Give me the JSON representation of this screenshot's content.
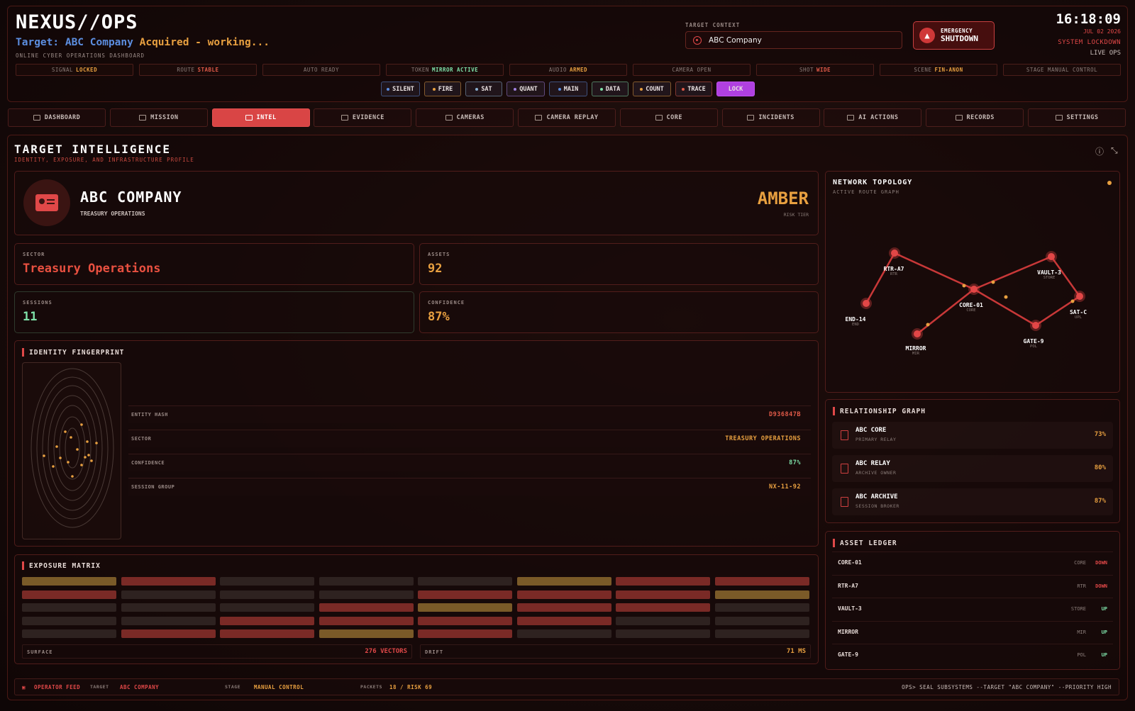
{
  "header": {
    "brand": "NEXUS//OPS",
    "acq_prefix": "Target: ABC Company",
    "acq_suffix": " Acquired - working...",
    "subtitle": "ONLINE CYBER OPERATIONS DASHBOARD",
    "target_context_label": "TARGET CONTEXT",
    "target_context_value": "ABC Company",
    "emergency_l1": "EMERGENCY",
    "emergency_l2": "SHUTDOWN",
    "clock": "16:18:09",
    "date": "JUL 02 2026",
    "lockdown": "SYSTEM LOCKDOWN",
    "live": "LIVE OPS"
  },
  "status": [
    {
      "k": "SIGNAL",
      "v": "LOCKED",
      "c": "#e8a040"
    },
    {
      "k": "ROUTE",
      "v": "STABLE",
      "c": "#e05a48"
    },
    {
      "k": "AUTO READY",
      "v": "",
      "c": "#8a7c78"
    },
    {
      "k": "TOKEN",
      "v": "MIRROR ACTIVE",
      "c": "#7ee0a8"
    },
    {
      "k": "AUDIO",
      "v": "ARMED",
      "c": "#e8a040"
    },
    {
      "k": "CAMERA OPEN",
      "v": "",
      "c": "#8a7c78"
    },
    {
      "k": "SHOT",
      "v": "WIDE",
      "c": "#e05a48"
    },
    {
      "k": "SCENE",
      "v": "FIN-ANON",
      "c": "#e8a040"
    },
    {
      "k": "STAGE MANUAL CONTROL",
      "v": "",
      "c": "#8a7c78"
    }
  ],
  "chips": [
    {
      "l": "SILENT",
      "c": "#5c8ee0"
    },
    {
      "l": "FIRE",
      "c": "#e8a040"
    },
    {
      "l": "SAT",
      "c": "#8ab0d0"
    },
    {
      "l": "QUANT",
      "c": "#a080e0"
    },
    {
      "l": "MAIN",
      "c": "#5c8ee0"
    },
    {
      "l": "DATA",
      "c": "#7ee0a8"
    },
    {
      "l": "COUNT",
      "c": "#e8a040"
    },
    {
      "l": "TRACE",
      "c": "#e05a48"
    },
    {
      "l": "LOCK",
      "c": "#c050f0"
    }
  ],
  "nav": [
    "DASHBOARD",
    "MISSION",
    "INTEL",
    "EVIDENCE",
    "CAMERAS",
    "CAMERA REPLAY",
    "CORE",
    "INCIDENTS",
    "AI ACTIONS",
    "RECORDS",
    "SETTINGS"
  ],
  "page": {
    "title": "TARGET INTELLIGENCE",
    "subtitle": "IDENTITY, EXPOSURE, AND INFRASTRUCTURE PROFILE"
  },
  "company": {
    "name": "ABC COMPANY",
    "sub": "TREASURY OPERATIONS",
    "tier": "AMBER",
    "tier_label": "RISK TIER"
  },
  "stats": {
    "sector_l": "SECTOR",
    "sector_v": "Treasury Operations",
    "assets_l": "ASSETS",
    "assets_v": "92",
    "sessions_l": "SESSIONS",
    "sessions_v": "11",
    "conf_l": "CONFIDENCE",
    "conf_v": "87%"
  },
  "fingerprint": {
    "title": "IDENTITY FINGERPRINT",
    "rows": [
      {
        "k": "ENTITY HASH",
        "v": "D936847B",
        "c": "#e05a48"
      },
      {
        "k": "SECTOR",
        "v": "TREASURY OPERATIONS",
        "c": "#e8a040"
      },
      {
        "k": "CONFIDENCE",
        "v": "87%",
        "c": "#7ee0a8"
      },
      {
        "k": "SESSION GROUP",
        "v": "NX-11-92",
        "c": "#e8a040"
      }
    ]
  },
  "exposure": {
    "title": "EXPOSURE MATRIX",
    "surface_l": "SURFACE",
    "surface_v": "276 VECTORS",
    "drift_l": "DRIFT",
    "drift_v": "71 MS",
    "cells": [
      [
        "a",
        "r",
        "d",
        "d",
        "d",
        "a",
        "r",
        "r"
      ],
      [
        "r",
        "d",
        "d",
        "d",
        "r",
        "r",
        "r",
        "a"
      ],
      [
        "d",
        "d",
        "d",
        "r",
        "a",
        "r",
        "r",
        "d"
      ],
      [
        "d",
        "d",
        "r",
        "r",
        "r",
        "r",
        "d",
        "d"
      ],
      [
        "d",
        "r",
        "r",
        "a",
        "r",
        "d",
        "d",
        "d"
      ]
    ]
  },
  "topology": {
    "title": "NETWORK TOPOLOGY",
    "sub": "ACTIVE ROUTE GRAPH",
    "nodes": [
      {
        "n": "RTR-A7",
        "t": "RTR"
      },
      {
        "n": "END-14",
        "t": "END"
      },
      {
        "n": "CORE-01",
        "t": "CORE"
      },
      {
        "n": "MIRROR",
        "t": "MIR"
      },
      {
        "n": "VAULT-3",
        "t": "STORE"
      },
      {
        "n": "GATE-9",
        "t": "POL"
      },
      {
        "n": "SAT-C",
        "t": "UPL"
      }
    ]
  },
  "relationship": {
    "title": "RELATIONSHIP GRAPH",
    "rows": [
      {
        "n": "ABC CORE",
        "s": "PRIMARY RELAY",
        "p": "73%"
      },
      {
        "n": "ABC RELAY",
        "s": "ARCHIVE OWNER",
        "p": "80%"
      },
      {
        "n": "ABC ARCHIVE",
        "s": "SESSION BROKER",
        "p": "87%"
      }
    ]
  },
  "ledger": {
    "title": "ASSET LEDGER",
    "rows": [
      {
        "n": "CORE-01",
        "k": "CORE",
        "s": "DOWN",
        "c": "#e04848"
      },
      {
        "n": "RTR-A7",
        "k": "RTR",
        "s": "DOWN",
        "c": "#e04848"
      },
      {
        "n": "VAULT-3",
        "k": "STORE",
        "s": "UP",
        "c": "#7ee0a8"
      },
      {
        "n": "MIRROR",
        "k": "MIR",
        "s": "UP",
        "c": "#7ee0a8"
      },
      {
        "n": "GATE-9",
        "k": "POL",
        "s": "UP",
        "c": "#7ee0a8"
      }
    ]
  },
  "footer": {
    "feed": "OPERATOR FEED",
    "target_l": "TARGET",
    "target_v": "ABC COMPANY",
    "stage_l": "STAGE",
    "stage_v": "MANUAL CONTROL",
    "packets_l": "PACKETS",
    "packets_v": "18 / RISK 69",
    "cmd": "OPS> SEAL SUBSYSTEMS --TARGET \"ABC COMPANY\" --PRIORITY HIGH"
  }
}
